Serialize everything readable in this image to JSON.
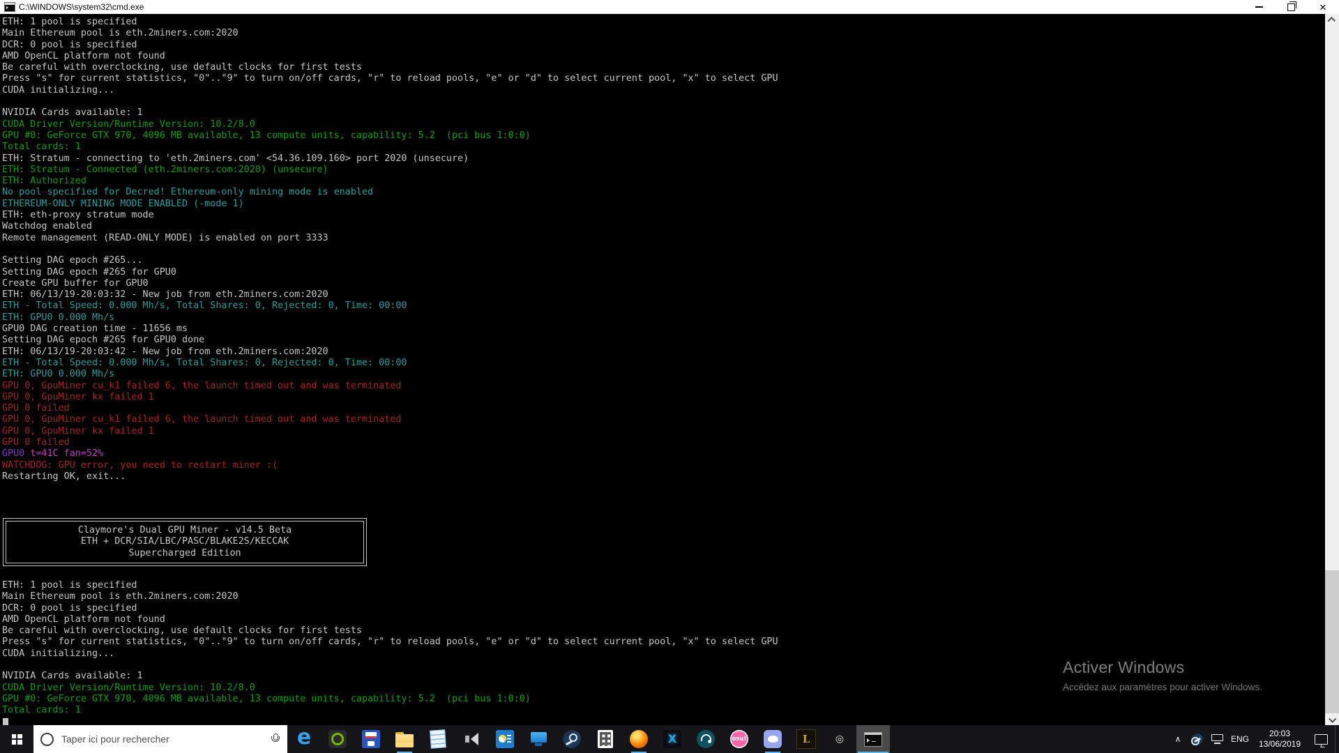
{
  "window": {
    "title": "C:\\WINDOWS\\system32\\cmd.exe",
    "controls": {
      "minimize": "minimize",
      "restore": "restore",
      "close": "✕"
    }
  },
  "console": {
    "colors": {
      "w": "#c6c6c6",
      "g": "#109e10",
      "c": "#2e9c9c",
      "r": "#a32424",
      "m": "#c040c0",
      "p": "#8138cc"
    },
    "accent": "#5ab3f0",
    "top_lines": [
      [
        [
          "ETH: 1 pool is specified",
          "w"
        ]
      ],
      [
        [
          "Main Ethereum pool is eth.2miners.com:2020",
          "w"
        ]
      ],
      [
        [
          "DCR: 0 pool is specified",
          "w"
        ]
      ],
      [
        [
          "AMD OpenCL platform not found",
          "w"
        ]
      ],
      [
        [
          "Be careful with overclocking, use default clocks for first tests",
          "w"
        ]
      ],
      [
        [
          "Press \"s\" for current statistics, \"0\"..\"9\" to turn on/off cards, \"r\" to reload pools, \"e\" or \"d\" to select current pool, \"x\" to select GPU",
          "w"
        ]
      ],
      [
        [
          "CUDA initializing...",
          "w"
        ]
      ],
      [],
      [
        [
          "NVIDIA Cards available: 1",
          "w"
        ]
      ],
      [
        [
          "CUDA Driver Version/Runtime Version: 10.2/8.0",
          "g"
        ]
      ],
      [
        [
          "GPU #0: GeForce GTX 970, 4096 MB available, 13 compute units, capability: 5.2  (pci bus 1:0:0)",
          "g"
        ]
      ],
      [
        [
          "Total cards: 1",
          "g"
        ]
      ],
      [
        [
          "ETH: Stratum - connecting to 'eth.2miners.com' <54.36.109.160> port 2020 (unsecure)",
          "w"
        ]
      ],
      [
        [
          "ETH: Stratum - Connected (eth.2miners.com:2020) (unsecure)",
          "g"
        ]
      ],
      [
        [
          "ETH: Authorized",
          "g"
        ]
      ],
      [
        [
          "No pool specified for Decred! Ethereum-only mining mode is enabled",
          "c"
        ]
      ],
      [
        [
          "ETHEREUM-ONLY MINING MODE ENABLED (-mode 1)",
          "c"
        ]
      ],
      [
        [
          "ETH: eth-proxy stratum mode",
          "w"
        ]
      ],
      [
        [
          "Watchdog enabled",
          "w"
        ]
      ],
      [
        [
          "Remote management (READ-ONLY MODE) is enabled on port 3333",
          "w"
        ]
      ],
      [],
      [
        [
          "Setting DAG epoch #265...",
          "w"
        ]
      ],
      [
        [
          "Setting DAG epoch #265 for GPU0",
          "w"
        ]
      ],
      [
        [
          "Create GPU buffer for GPU0",
          "w"
        ]
      ],
      [
        [
          "ETH: 06/13/19-20:03:32 - New job from eth.2miners.com:2020",
          "w"
        ]
      ],
      [
        [
          "ETH - Total Speed: 0.000 Mh/s, Total Shares: 0, Rejected: 0, Time: 00:00",
          "c"
        ]
      ],
      [
        [
          "ETH: GPU0 0.000 Mh/s",
          "c"
        ]
      ],
      [
        [
          "GPU0 DAG creation time - 11656 ms",
          "w"
        ]
      ],
      [
        [
          "Setting DAG epoch #265 for GPU0 done",
          "w"
        ]
      ],
      [
        [
          "ETH: 06/13/19-20:03:42 - New job from eth.2miners.com:2020",
          "w"
        ]
      ],
      [
        [
          "ETH - Total Speed: 0.000 Mh/s, Total Shares: 0, Rejected: 0, Time: 00:00",
          "c"
        ]
      ],
      [
        [
          "ETH: GPU0 0.000 Mh/s",
          "c"
        ]
      ],
      [
        [
          "GPU 0, GpuMiner cu_k1 failed 6, the launch timed out and was terminated",
          "r"
        ]
      ],
      [
        [
          "GPU 0, GpuMiner kx failed 1",
          "r"
        ]
      ],
      [
        [
          "GPU 0 failed",
          "r"
        ]
      ],
      [
        [
          "GPU 0, GpuMiner cu_k1 failed 6, the launch timed out and was terminated",
          "r"
        ]
      ],
      [
        [
          "GPU 0, GpuMiner kx failed 1",
          "r"
        ]
      ],
      [
        [
          "GPU 0 failed",
          "r"
        ]
      ],
      [
        [
          "GPU0 ",
          "p"
        ],
        [
          "t=41C fan=52%",
          "m"
        ]
      ],
      [
        [
          "WATCHDOG: GPU error, you need to restart miner :(",
          "r"
        ]
      ],
      [
        [
          "Restarting OK, exit...",
          "w"
        ]
      ],
      [],
      [],
      []
    ],
    "banner": {
      "l1": "Claymore's Dual GPU Miner - v14.5 Beta",
      "l2": "ETH + DCR/SIA/LBC/PASC/BLAKE2S/KECCAK",
      "l3": "Supercharged Edition"
    },
    "bottom_lines": [
      [
        [
          "ETH: 1 pool is specified",
          "w"
        ]
      ],
      [
        [
          "Main Ethereum pool is eth.2miners.com:2020",
          "w"
        ]
      ],
      [
        [
          "DCR: 0 pool is specified",
          "w"
        ]
      ],
      [
        [
          "AMD OpenCL platform not found",
          "w"
        ]
      ],
      [
        [
          "Be careful with overclocking, use default clocks for first tests",
          "w"
        ]
      ],
      [
        [
          "Press \"s\" for current statistics, \"0\"..\"9\" to turn on/off cards, \"r\" to reload pools, \"e\" or \"d\" to select current pool, \"x\" to select GPU",
          "w"
        ]
      ],
      [
        [
          "CUDA initializing...",
          "w"
        ]
      ],
      [],
      [
        [
          "NVIDIA Cards available: 1",
          "w"
        ]
      ],
      [
        [
          "CUDA Driver Version/Runtime Version: 10.2/8.0",
          "g"
        ]
      ],
      [
        [
          "GPU #0: GeForce GTX 970, 4096 MB available, 13 compute units, capability: 5.2  (pci bus 1:0:0)",
          "g"
        ]
      ],
      [
        [
          "Total cards: 1",
          "g"
        ]
      ]
    ]
  },
  "watermark": {
    "title": "Activer Windows",
    "subtitle": "Accédez aux paramètres pour activer Windows."
  },
  "taskbar": {
    "search_placeholder": "Taper ici pour rechercher",
    "apps": [
      {
        "id": "edge",
        "glyph": "e",
        "running": false,
        "active": false
      },
      {
        "id": "nvidia",
        "glyph": "",
        "running": false,
        "active": false
      },
      {
        "id": "save",
        "glyph": "",
        "running": false,
        "active": false
      },
      {
        "id": "explorer",
        "glyph": "",
        "running": true,
        "active": false
      },
      {
        "id": "notepad",
        "glyph": "",
        "running": false,
        "active": false
      },
      {
        "id": "speaker",
        "glyph": "",
        "running": false,
        "active": false
      },
      {
        "id": "system",
        "glyph": "",
        "running": false,
        "active": false
      },
      {
        "id": "monitor",
        "glyph": "",
        "running": false,
        "active": false
      },
      {
        "id": "steam",
        "glyph": "",
        "running": false,
        "active": false
      },
      {
        "id": "calculator",
        "glyph": "",
        "running": false,
        "active": false
      },
      {
        "id": "firefox",
        "glyph": "",
        "running": true,
        "active": false
      },
      {
        "id": "game",
        "glyph": "X",
        "running": false,
        "active": false
      },
      {
        "id": "headset",
        "glyph": "",
        "running": false,
        "active": false
      },
      {
        "id": "osu",
        "glyph": "osu!",
        "running": false,
        "active": false
      },
      {
        "id": "discord",
        "glyph": "",
        "running": true,
        "active": false
      },
      {
        "id": "lol",
        "glyph": "L",
        "running": false,
        "active": false
      },
      {
        "id": "spiral",
        "glyph": "◎",
        "running": false,
        "active": false
      },
      {
        "id": "cmd",
        "glyph": "",
        "running": true,
        "active": true
      }
    ],
    "tray": {
      "chevron": "∧",
      "language": "ENG",
      "time": "20:03",
      "date": "13/06/2019"
    }
  }
}
